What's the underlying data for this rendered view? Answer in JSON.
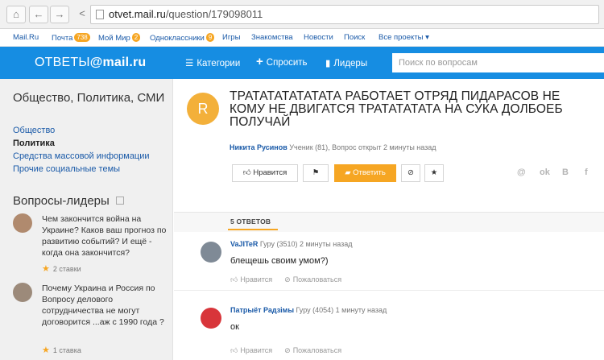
{
  "browser": {
    "url_host": "otvet.mail.ru",
    "url_path": "/question/179098011"
  },
  "portal": {
    "items": [
      {
        "label": "Mail.Ru",
        "badge": ""
      },
      {
        "label": "Почта",
        "badge": "738"
      },
      {
        "label": "Мой Мир",
        "badge": "2"
      },
      {
        "label": "Одноклассники",
        "badge": "9"
      },
      {
        "label": "Игры",
        "badge": ""
      },
      {
        "label": "Знакомства",
        "badge": ""
      },
      {
        "label": "Новости",
        "badge": ""
      },
      {
        "label": "Поиск",
        "badge": ""
      },
      {
        "label": "Все проекты ▾",
        "badge": ""
      }
    ]
  },
  "header": {
    "logo_left": "ОТВЕТЫ",
    "logo_right": "@mail.ru",
    "nav": [
      "Категории",
      "Спросить",
      "Лидеры"
    ],
    "search_placeholder": "Поиск по вопросам",
    "accent": "#168de2"
  },
  "sidebar": {
    "category_title": "Общество, Политика, СМИ",
    "links": [
      "Общество",
      "Политика",
      "Средства массовой информации",
      "Прочие социальные темы"
    ],
    "leaders_title": "Вопросы-лидеры",
    "leaders": [
      {
        "text": "Чем закончится война на Украине? Каков ваш прогноз по развитию событий? И ещё - когда она закончится?",
        "bets": "2 ставки"
      },
      {
        "text": "Почему Украина и Россия по Вопросу делового сотрудничества не могут договорится ...аж с 1990 года ?",
        "bets": "1 ставка"
      }
    ]
  },
  "question": {
    "avatar_letter": "R",
    "title": "ТРАТАТАТАТАТАТА РАБОТАЕТ ОТРЯД ПИДАРАСОВ НЕ КОМУ НЕ ДВИГАТСЯ ТРАТАТАТАТА НА СУКА ДОЛБОЕБ ПОЛУЧАЙ",
    "author": "Никита Русинов",
    "meta": "Ученик (81), Вопрос открыт 2 минуты назад",
    "like_label": "Нравится",
    "answer_label": "Ответить",
    "share": [
      "@",
      "ok",
      "В",
      "f"
    ]
  },
  "answers_header": "5 ОТВЕТОВ",
  "answers": [
    {
      "name": "VaJITeR",
      "meta": "Гуру (3510) 2 минуты назад",
      "text": "блещешь своим умом?)",
      "like": "Нравится",
      "complain": "Пожаловаться"
    },
    {
      "name": "Патрыёт Радзімы",
      "meta": "Гуру (4054) 1 минуту назад",
      "text": "ок",
      "like": "Нравится",
      "complain": "Пожаловаться"
    }
  ]
}
